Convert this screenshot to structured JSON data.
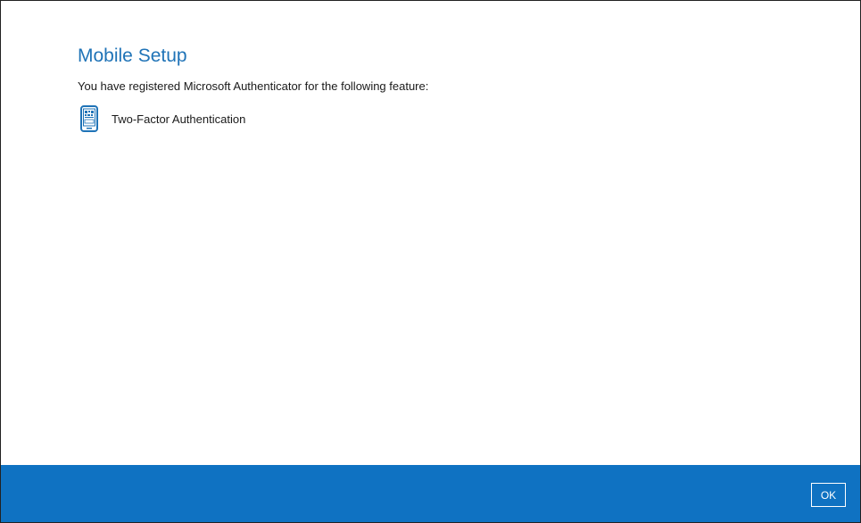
{
  "dialog": {
    "title": "Mobile Setup",
    "description": "You have registered Microsoft Authenticator for the following feature:",
    "features": [
      {
        "icon": "mobile-authenticator-icon",
        "label": "Two-Factor Authentication"
      }
    ]
  },
  "footer": {
    "ok_label": "OK"
  },
  "colors": {
    "title": "#1f73b7",
    "footer_background": "#0f72c2",
    "icon": "#1f73b7",
    "window_border": "#222222"
  }
}
